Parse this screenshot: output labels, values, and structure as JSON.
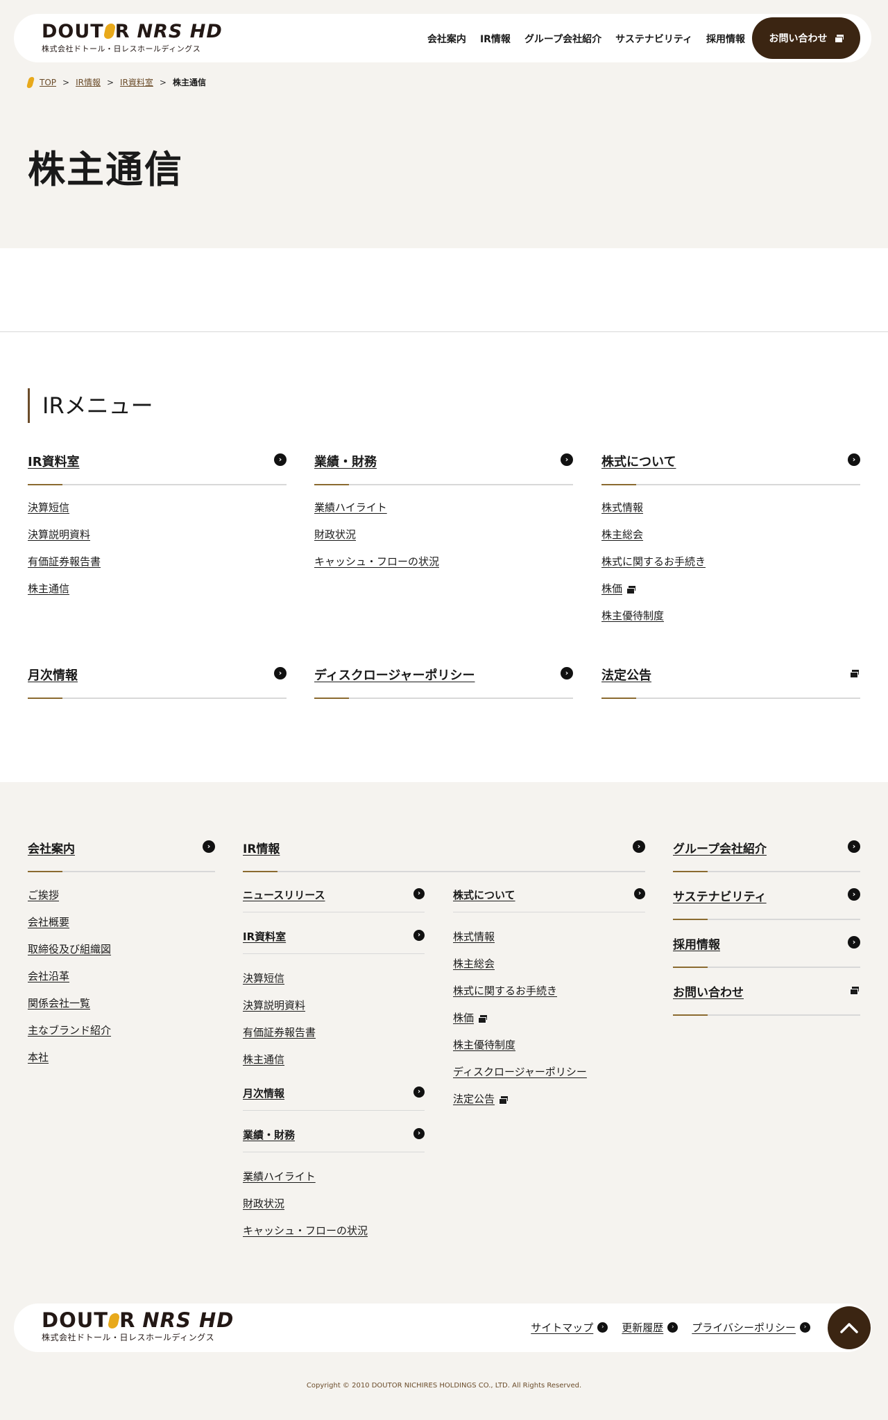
{
  "header": {
    "logo_main": "DOUTOR NRS HD",
    "logo_sub": "株式会社ドトール・日レスホールディングス",
    "nav": [
      "会社案内",
      "IR情報",
      "グループ会社紹介",
      "サステナビリティ",
      "採用情報"
    ],
    "contact_label": "お問い合わせ"
  },
  "breadcrumb": {
    "items": [
      "TOP",
      "IR情報",
      "IR資料室"
    ],
    "current": "株主通信"
  },
  "page_title": "株主通信",
  "ir_menu": {
    "title": "IRメニュー",
    "columns": [
      {
        "title": "IR資料室",
        "items": [
          "決算短信",
          "決算説明資料",
          "有価証券報告書",
          "株主通信"
        ]
      },
      {
        "title": "業績・財務",
        "items": [
          "業績ハイライト",
          "財政状況",
          "キャッシュ・フローの状況"
        ]
      },
      {
        "title": "株式について",
        "items": [
          "株式情報",
          "株主総会",
          "株式に関するお手続き",
          "株価",
          "株主優待制度"
        ]
      }
    ],
    "row2": [
      "月次情報",
      "ディスクロージャーポリシー",
      "法定公告"
    ]
  },
  "footer": {
    "company": {
      "title": "会社案内",
      "items": [
        "ご挨拶",
        "会社概要",
        "取締役及び組織図",
        "会社沿革",
        "関係会社一覧",
        "主なブランド紹介",
        "本社"
      ]
    },
    "ir": {
      "title": "IR情報",
      "news": "ニュースリリース",
      "library": {
        "title": "IR資料室",
        "items": [
          "決算短信",
          "決算説明資料",
          "有価証券報告書",
          "株主通信"
        ]
      },
      "monthly": "月次情報",
      "finance": {
        "title": "業績・財務",
        "items": [
          "業績ハイライト",
          "財政状況",
          "キャッシュ・フローの状況"
        ]
      },
      "stock": {
        "title": "株式について",
        "items": [
          "株式情報",
          "株主総会",
          "株式に関するお手続き",
          "株価",
          "株主優待制度",
          "ディスクロージャーポリシー",
          "法定公告"
        ]
      }
    },
    "right": [
      "グループ会社紹介",
      "サステナビリティ",
      "採用情報",
      "お問い合わせ"
    ],
    "bottom_links": [
      "サイトマップ",
      "更新履歴",
      "プライバシーポリシー"
    ],
    "copyright": "Copyright © 2010 DOUTOR NICHIRES HOLDINGS CO., LTD. All Rights Reserved."
  },
  "colors": {
    "accent": "#3b2512",
    "gold": "#e8a91b",
    "underline": "#8a6a2f"
  },
  "icons": {
    "arrow": "chevron-right-icon",
    "external": "external-window-icon",
    "pagetop": "chevron-up-icon"
  }
}
